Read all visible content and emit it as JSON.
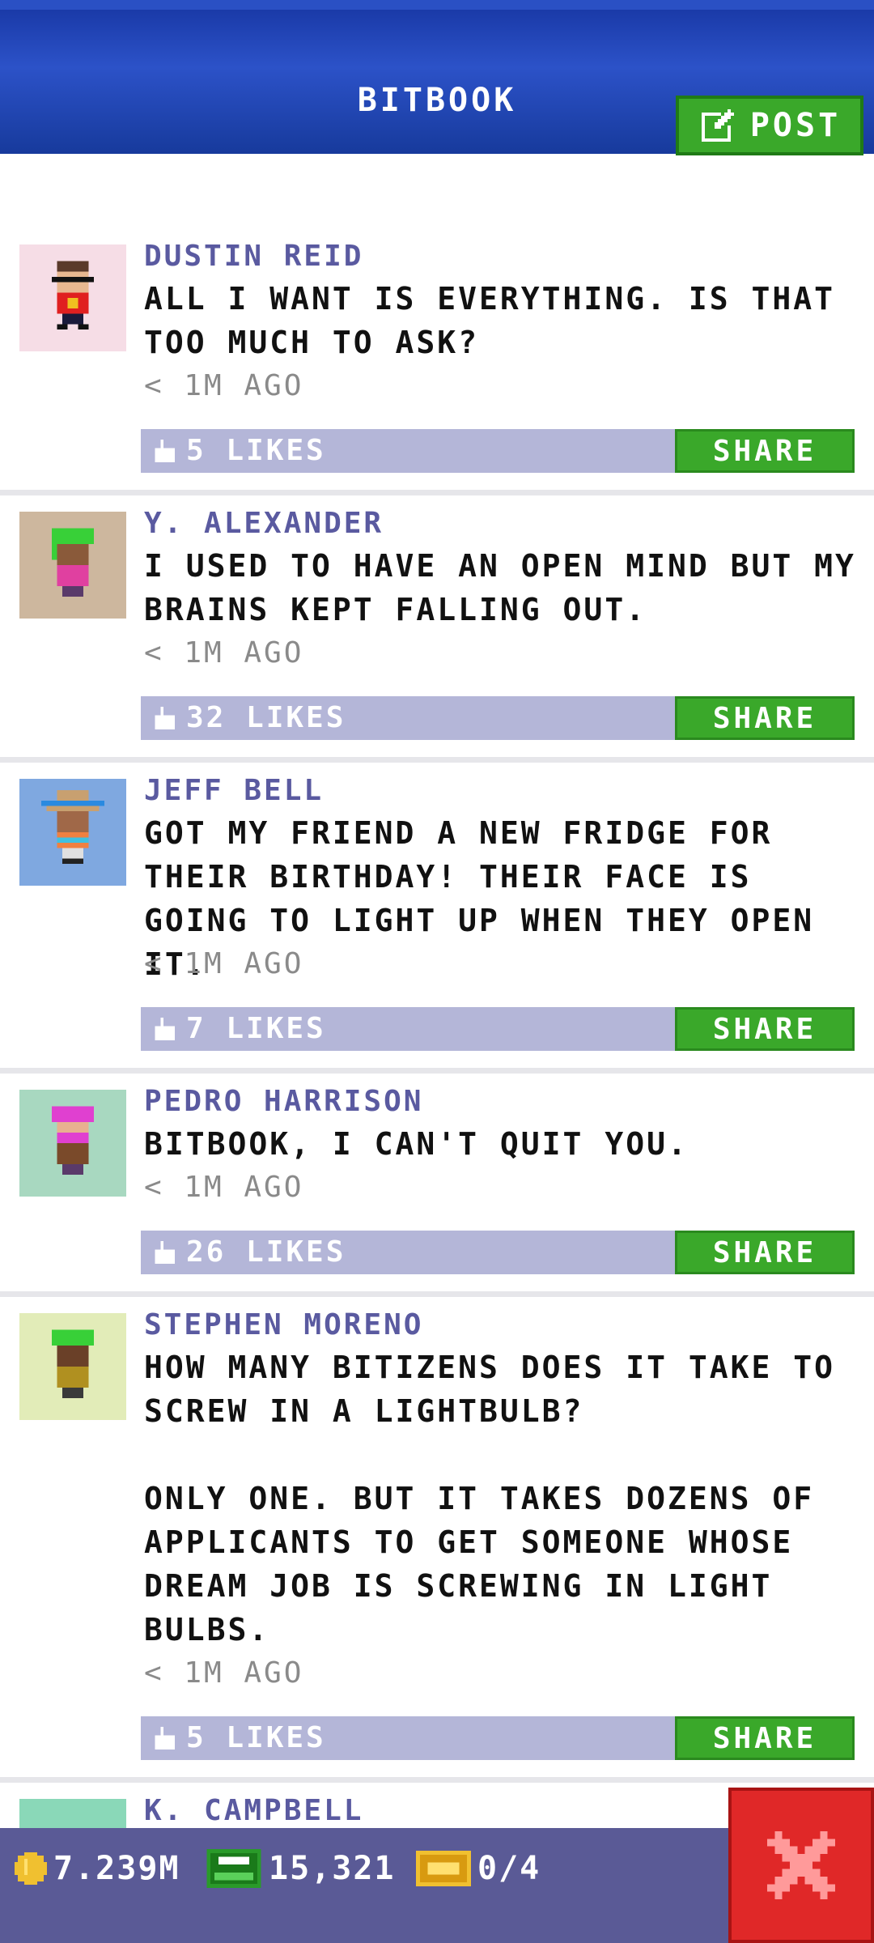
{
  "header": {
    "title": "BITBOOK",
    "post_label": "POST"
  },
  "posts": [
    {
      "name": "DUSTIN REID",
      "message": "ALL I WANT IS EVERYTHING. IS THAT TOO MUCH TO ASK?",
      "time": "< 1M AGO",
      "likes": "5 LIKES",
      "share": "SHARE"
    },
    {
      "name": "Y. ALEXANDER",
      "message": "I USED TO HAVE AN OPEN MIND BUT MY BRAINS KEPT FALLING OUT.",
      "time": "< 1M AGO",
      "likes": "32 LIKES",
      "share": "SHARE"
    },
    {
      "name": "JEFF BELL",
      "message": "GOT MY FRIEND A NEW FRIDGE FOR THEIR BIRTHDAY! THEIR FACE IS GOING TO LIGHT UP WHEN THEY OPEN IT.",
      "time": "< 1M AGO",
      "likes": "7 LIKES",
      "share": "SHARE"
    },
    {
      "name": "PEDRO HARRISON",
      "message": "BITBOOK, I CAN'T QUIT YOU.",
      "time": "< 1M AGO",
      "likes": "26 LIKES",
      "share": "SHARE"
    },
    {
      "name": "STEPHEN MORENO",
      "message": "HOW MANY BITIZENS DOES IT TAKE TO SCREW IN A LIGHTBULB?\n\nONLY ONE. BUT IT TAKES DOZENS OF APPLICANTS TO GET SOMEONE WHOSE DREAM JOB IS SCREWING IN LIGHT BULBS.",
      "time": "< 1M AGO",
      "likes": "5 LIKES",
      "share": "SHARE"
    },
    {
      "name": "K. CAMPBELL"
    }
  ],
  "status": {
    "coins": "7.239M",
    "bux": "15,321",
    "tickets": "0/4"
  },
  "colors": {
    "header_blue": "#2c52c8",
    "share_green": "#3aa82a",
    "like_bar": "#b4b6d8",
    "name_purple": "#5a5aa0",
    "close_red": "#e02828"
  }
}
